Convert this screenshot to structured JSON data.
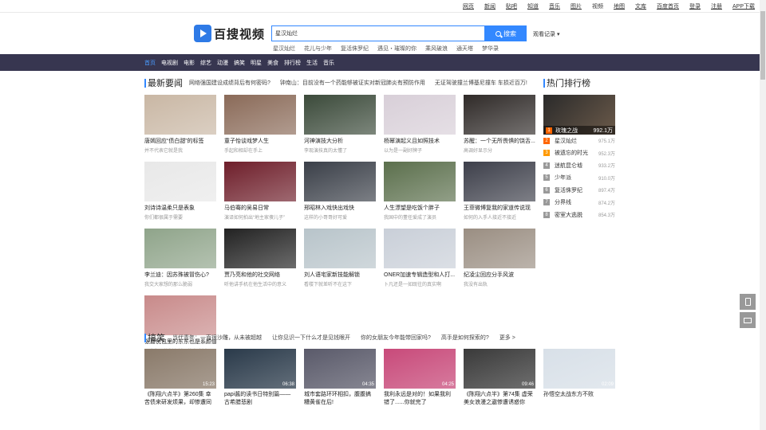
{
  "toplinks": [
    "网页",
    "新闻",
    "贴吧",
    "知道",
    "音乐",
    "图片",
    "视频",
    "地图",
    "文库",
    "百度首页",
    "登录",
    "注册",
    "APP下载"
  ],
  "logo": {
    "text": "百搜视频"
  },
  "search": {
    "value": "星汉灿烂",
    "button": "搜索",
    "history": "观看记录"
  },
  "suggest": [
    "星汉灿烂",
    "花儿与少年",
    "复活侏罗纪",
    "遇见・璀璨的你",
    "乘风破浪",
    "通天塔",
    "梦华录"
  ],
  "nav": [
    "首页",
    "电视剧",
    "电影",
    "综艺",
    "动漫",
    "搞笑",
    "明星",
    "美食",
    "排行榜",
    "生活",
    "音乐"
  ],
  "news": {
    "title": "最新要闻",
    "ticker": [
      "网络强国建设成绩背后有何密码?",
      "钟南山：目前没有一个药能够被证实对新冠肺炎有预防作用",
      "无证驾驶撞兰博基尼撞车 车损近百万!"
    ]
  },
  "cards": [
    {
      "t1": "唐嫣回应“债白甜”的标签",
      "t2": "并不代表它就是我",
      "c": "#c9b7a4"
    },
    {
      "t1": "童子怡谈戏梦人生",
      "t2": "手起和相却在手上",
      "c": "#8a6a58"
    },
    {
      "t1": "河神演技大分析",
      "t2": "李现演技真的太懂了",
      "c": "#3b4a3a"
    },
    {
      "t1": "杨幂演起义且如照技术",
      "t2": "以为是一副好牌子",
      "c": "#d8cfd8"
    },
    {
      "t1": "苏醒：一个无所畏惧的饶舌...",
      "t2": "高调好显示分",
      "c": "#2f2a28"
    },
    {
      "t1": "刘诗诗温柔只是表象",
      "t2": "你们都很属于需要",
      "c": "#e8e8e8"
    },
    {
      "t1": "马伯骞的吴易日常",
      "t2": "演译如何拍出“地主家傻儿子”",
      "c": "#6e1e2a"
    },
    {
      "t1": "邢昭林入戏快出戏快",
      "t2": "这样的小哥哥好可爱",
      "c": "#3a3f48"
    },
    {
      "t1": "人生漂望是吃饭个胖子",
      "t2": "我国中的董任爱成了演员",
      "c": "#5b6f4c"
    },
    {
      "t1": "王菲微博复我的家道传说现",
      "t2": "如何的入手人接近不接近",
      "c": "#3d3f4a"
    },
    {
      "t1": "李兰迪：因苏殊被冒伤心?",
      "t2": "我交大家想的那么脆弱",
      "c": "#8fa48a"
    },
    {
      "t1": "贾乃亮和他的社交网络",
      "t2": "听他讲手机在他生活中的意义",
      "c": "#222222"
    },
    {
      "t1": "刘人语宅家新技能解锁",
      "t2": "看楼下就差听不在这下",
      "c": "#b8c4ca"
    },
    {
      "t1": "ONER加速专辑造型和人打...",
      "t2": "卜凡还是一如既往的真实啊",
      "c": "#c9cfd8"
    },
    {
      "t1": "纪凌尘回应分手风波",
      "t2": "我没有出轨",
      "c": "#9a8e82"
    },
    {
      "t1": "张嘉倪包里的东东也是系颜值",
      "t2": "不会为了控制身材而放弃晚饭",
      "c": "#c88a8a"
    }
  ],
  "rank": {
    "title": "热门排行榜",
    "items": [
      {
        "n": "1",
        "name": "玫瑰之战",
        "v": "992.1万",
        "c": "#ff6600"
      },
      {
        "n": "2",
        "name": "星汉灿烂",
        "v": "975.1万",
        "c": "#ff6600"
      },
      {
        "n": "3",
        "name": "被遗忘的时光",
        "v": "952.3万",
        "c": "#ff9900"
      },
      {
        "n": "4",
        "name": "迷航昆仑墟",
        "v": "933.2万",
        "c": "#999999"
      },
      {
        "n": "5",
        "name": "少年派",
        "v": "910.0万",
        "c": "#999999"
      },
      {
        "n": "6",
        "name": "复活侏罗纪",
        "v": "897.4万",
        "c": "#999999"
      },
      {
        "n": "7",
        "name": "分界线",
        "v": "874.2万",
        "c": "#999999"
      },
      {
        "n": "8",
        "name": "密室大逃脱",
        "v": "854.3万",
        "c": "#999999"
      }
    ]
  },
  "funny": {
    "title": "搞笑",
    "links": [
      "当代青年：一直很沙雕，从未被超越",
      "让你见识一下什么才是见钱眼开",
      "你的女朋友今年能带回家吗?",
      "高手是如何探索的?",
      "更多 >"
    ]
  },
  "funny_cards": [
    {
      "t1": "《陈翔六点半》第260集 幸苦债来研发烦果，却惨遭同事见",
      "d": "15:23",
      "c": "#8a7a6a"
    },
    {
      "t1": "papi酱的读书日特别篇——古希腊悲剧",
      "d": "06:38",
      "c": "#2a3a4a"
    },
    {
      "t1": "城市套路环环相扣，腹腹搞糟黄雀在后!",
      "d": "04:35",
      "c": "#5a5a6a"
    },
    {
      "t1": "我利永远是对的！如果我利错了......你就完了",
      "d": "04:25",
      "c": "#c84a7a"
    },
    {
      "t1": "《陈翔六点半》第74集 虚荣美女浪漫之遨惨遭诱惑你",
      "d": "09:46",
      "c": "#3a3a3a"
    },
    {
      "t1": "孙悟空太战东方不败",
      "d": "02:09",
      "c": "#d8e0e8"
    }
  ]
}
